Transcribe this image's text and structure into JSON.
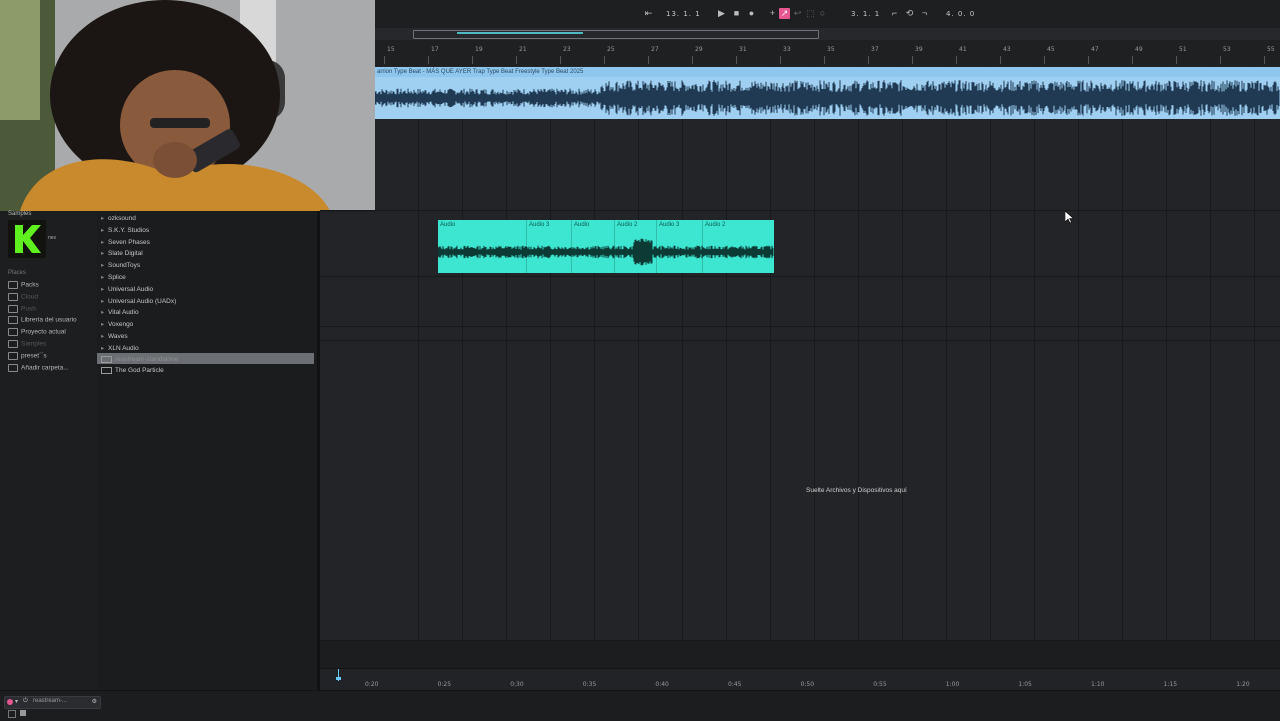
{
  "transport": {
    "arrangement_position": "13. 1. 1",
    "loop_start": "3. 1. 1",
    "loop_length": "4. 0. 0"
  },
  "ruler": {
    "bars": [
      "15",
      "17",
      "19",
      "21",
      "23",
      "25",
      "27",
      "29",
      "31",
      "33",
      "35",
      "37",
      "39",
      "41",
      "43",
      "45",
      "47",
      "49",
      "51",
      "53",
      "55"
    ]
  },
  "tracks": {
    "beat_clip_name": "arrion Type Beat - MÁS QUE AYER  Trap Type Beat  Freestyle Type Beat 2025",
    "vox_clips": [
      {
        "label": "Audio"
      },
      {
        "label": "Audio 3"
      },
      {
        "label": "Audio"
      },
      {
        "label": "Audio 2"
      },
      {
        "label": "Audio 3"
      },
      {
        "label": "Audio 2"
      }
    ],
    "drop_hint": "Suelte Archivos y Dispositivos aquí"
  },
  "browser": {
    "header_label": "Samples",
    "logo_text": "nes",
    "places_title": "Places",
    "places": [
      {
        "label": "Packs",
        "dim": false
      },
      {
        "label": "Cloud",
        "dim": true
      },
      {
        "label": "Push",
        "dim": true
      },
      {
        "label": "Librería del usuario",
        "dim": false
      },
      {
        "label": "Proyecto actual",
        "dim": false
      },
      {
        "label": "Samples",
        "dim": true
      },
      {
        "label": "preset´´s",
        "dim": false
      },
      {
        "label": "Añadir carpeta...",
        "dim": false
      }
    ],
    "items": [
      {
        "label": "ozksound"
      },
      {
        "label": "S.K.Y. Studios"
      },
      {
        "label": "Seven Phases"
      },
      {
        "label": "Slate Digital"
      },
      {
        "label": "SoundToys"
      },
      {
        "label": "Splice"
      },
      {
        "label": "Universal Audio"
      },
      {
        "label": "Universal Audio (UADx)"
      },
      {
        "label": "Vital Audio"
      },
      {
        "label": "Voxengo"
      },
      {
        "label": "Waves"
      },
      {
        "label": "XLN Audio"
      },
      {
        "label": "reastream-standalone"
      },
      {
        "label": "The God Particle"
      }
    ]
  },
  "timeline": {
    "labels": [
      "0:20",
      "0:25",
      "0:30",
      "0:35",
      "0:40",
      "0:45",
      "0:50",
      "0:55",
      "1:00",
      "1:05",
      "1:10",
      "1:15",
      "1:20"
    ]
  },
  "status": {
    "track_name": "reastream-..."
  },
  "colors": {
    "beat_clip": "#9fd0f2",
    "vox_clip": "#3de6d0",
    "selected_row": "#6b6f74",
    "record_accent": "#e6568f"
  }
}
